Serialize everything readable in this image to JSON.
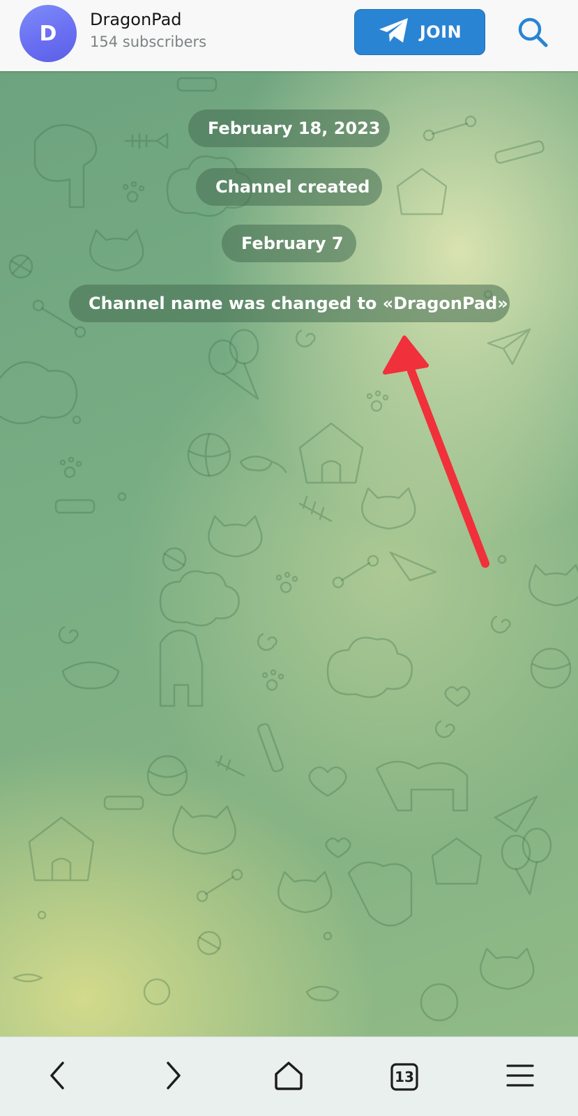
{
  "header": {
    "avatar_letter": "D",
    "channel_name": "DragonPad",
    "subscribers": "154 subscribers",
    "join_label": "JOIN",
    "join_icon": "telegram-plane-icon",
    "search_icon": "search-icon"
  },
  "chat": {
    "messages": [
      {
        "type": "date",
        "text": "February 18, 2023"
      },
      {
        "type": "service",
        "text": "Channel created"
      },
      {
        "type": "date",
        "text": "February 7"
      },
      {
        "type": "service",
        "text": "Channel name was changed to «DragonPad»"
      }
    ],
    "annotation": "red-arrow-pointer"
  },
  "bottom_bar": {
    "back_icon": "chevron-left-icon",
    "forward_icon": "chevron-right-icon",
    "home_icon": "home-icon",
    "tabs_count": "13",
    "menu_icon": "menu-icon"
  },
  "colors": {
    "accent": "#2a84d4",
    "avatar": "#6a6ff2",
    "pill_bg": "#466e52",
    "arrow": "#f0303a"
  }
}
